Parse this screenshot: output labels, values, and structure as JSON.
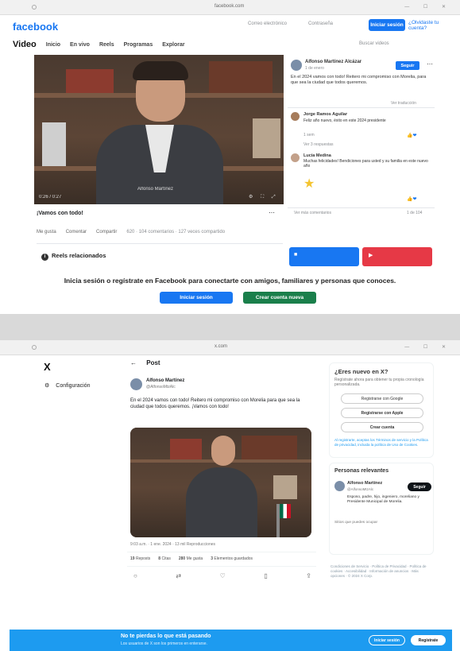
{
  "facebook": {
    "logo": "facebook",
    "header_email_placeholder": "Correo electrónico",
    "header_password_placeholder": "Contraseña",
    "login_button": "Iniciar sesión",
    "forgot_link": "¿Olvidaste tu cuenta?",
    "nav": {
      "title": "Video",
      "items": [
        "Inicio",
        "En vivo",
        "Reels",
        "Programas",
        "Explorar"
      ]
    },
    "search_placeholder": "Buscar videos",
    "video_caption": "Alfonso Martínez",
    "video_time": "0:26 / 0:27",
    "post": {
      "author": "Alfonso Martínez Alcázar",
      "verified_label": "✓",
      "time": "1 de enero",
      "text": "En el 2024 vamos con todo! Reitero mi compromiso con Morelia, para que sea la ciudad que todos queremos.",
      "follow": "Seguir",
      "translate": "Ver traducción",
      "comment1_author": "Jorge Ramos Aguilar",
      "comment1_text": "Feliz año nuevo, éxito en este 2024 presidente",
      "comment2_author": "Lucía Medina",
      "comment2_text": "Muchas felicidades! Bendiciones para usted y su familia en este nuevo año",
      "comment_time": "1 sem",
      "reply": "Ver 3 respuestas",
      "comment_count": "Comentarios",
      "reaction_count": "620",
      "more_comments": "Ver más comentarios",
      "comments_total": "1 de 104"
    },
    "below_title": "¡Vamos con todo!",
    "actions": [
      "Me gusta",
      "Comentar",
      "Compartir"
    ],
    "stats": "620 · 104 comentarios · 127 veces compartido",
    "related_title": "Reels relacionados",
    "login_message": "Inicia sesión o regístrate en Facebook para conectarte con amigos, familiares y personas que conoces.",
    "cta_login": "Iniciar sesión",
    "cta_signup": "Crear cuenta nueva",
    "colors": {
      "brand": "#1877f2",
      "signup": "#42b72a",
      "red": "#e63946"
    }
  },
  "twitter": {
    "logo": "X",
    "settings": "Configuración",
    "post_header": "Post",
    "author": "Alfonso Martínez",
    "handle": "@AlfonsoMtzAlc",
    "text": "En el 2024 vamos con todo! Reitero mi compromiso con Morelia para que sea la ciudad que todos queremos. ¡Vamos con todo!",
    "meta": "9:03 a.m. · 1 ene. 2024 · 13 mil Reproducciones",
    "stats": [
      {
        "value": "19",
        "label": "Reposts"
      },
      {
        "value": "8",
        "label": "Citas"
      },
      {
        "value": "280",
        "label": "Me gusta"
      },
      {
        "value": "3",
        "label": "Elementos guardados"
      }
    ],
    "right": {
      "new_title": "¿Eres nuevo en X?",
      "new_sub": "Regístrate ahora para obtener tu propia cronología personalizada.",
      "google": "Registrarse con Google",
      "apple": "Registrarse con Apple",
      "create": "Crear cuenta",
      "terms": "Al registrarte, aceptas los Términos de servicio y la Política de privacidad, incluida la política de Uso de Cookies.",
      "people_title": "Personas relevantes",
      "person_name": "Alfonso Martínez",
      "person_handle": "@AlfonsoMtzAlc",
      "person_follow": "Seguir",
      "person_bio": "Esposo, padre, hijo, ingeniero, moreliano y Presidente Municipal de Morelia.",
      "trends": "Sitios que puedes ocupar",
      "footer": "Condiciones de Servicio · Política de Privacidad · Política de cookies · Accesibilidad · Información de anuncios · Más opciones · © 2024 X Corp."
    },
    "banner_title": "No te pierdas lo que está pasando",
    "banner_sub": "Los usuarios de X son los primeros en enterarse.",
    "banner_login": "Iniciar sesión",
    "banner_signup": "Regístrate",
    "colors": {
      "brand": "#1d9bf0"
    }
  }
}
